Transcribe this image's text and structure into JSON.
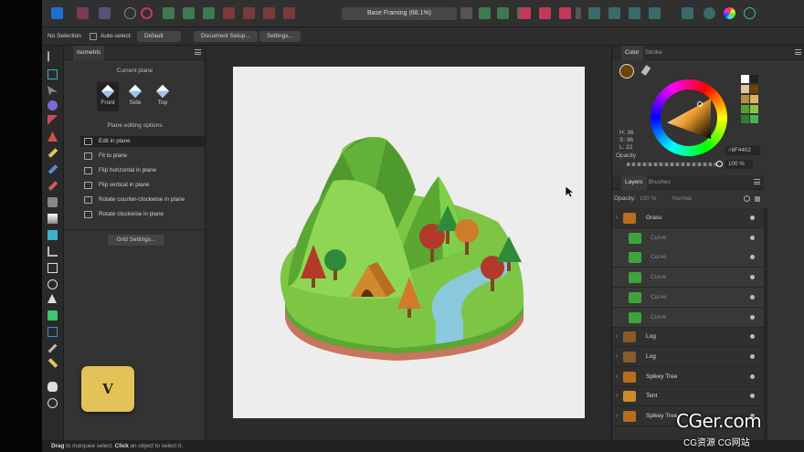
{
  "toolbar": {
    "document_title": "Base Framing (68.1%)"
  },
  "context": {
    "selection": "No Selection",
    "auto_select_label": "Auto-select:",
    "auto_select_value": "Default",
    "doc_setup": "Document Setup...",
    "settings": "Settings..."
  },
  "isometric_panel": {
    "tab": "Isometric",
    "current_plane_label": "Current plane",
    "planes": [
      {
        "label": "Front"
      },
      {
        "label": "Side"
      },
      {
        "label": "Top"
      }
    ],
    "editing_label": "Plane editing options",
    "options": [
      {
        "label": "Edit in plane"
      },
      {
        "label": "Fit to plane"
      },
      {
        "label": "Flip horizontal in plane"
      },
      {
        "label": "Flip vertical in plane"
      },
      {
        "label": "Rotate counter-clockwise in plane"
      },
      {
        "label": "Rotate clockwise in plane"
      }
    ],
    "grid_settings": "Grid Settings..."
  },
  "color_panel": {
    "tabs": [
      "Color",
      "Stroke"
    ],
    "h": "H: 36",
    "s": "S: 96",
    "l": "L: 22",
    "hex": "6F4402",
    "opacity_label": "Opacity",
    "opacity_value": "100 %",
    "swatches": [
      "#ffffff",
      "#222222",
      "#e0c79a",
      "#6f4402",
      "#b78a4a",
      "#d9b26a",
      "#5a9e2f",
      "#8bc34a",
      "#2e7d32",
      "#4caf50"
    ]
  },
  "layers_panel": {
    "tabs": [
      "Layers",
      "Brushes"
    ],
    "opacity_label": "Opacity:",
    "opacity_value": "100 %",
    "blend": "Normal",
    "items": [
      {
        "name": "Grass",
        "indent": false
      },
      {
        "name": "Curve",
        "indent": true
      },
      {
        "name": "Curve",
        "indent": true
      },
      {
        "name": "Curve",
        "indent": true
      },
      {
        "name": "Curve",
        "indent": true
      },
      {
        "name": "Curve",
        "indent": true
      },
      {
        "name": "Log",
        "indent": false
      },
      {
        "name": "Log",
        "indent": false
      },
      {
        "name": "Spikey Tree",
        "indent": false
      },
      {
        "name": "Tent",
        "indent": false
      },
      {
        "name": "Spikey Tree",
        "indent": false
      }
    ]
  },
  "status": {
    "drag": "Drag",
    "mid": " to marquee select. ",
    "click": "Click",
    "end": " an object to select it."
  },
  "key_overlay": "V",
  "watermark": {
    "line1": "CGer.com",
    "line2": "CG资源 CG网站"
  },
  "colors": {
    "accent": "#3d8fd6",
    "key": "#e3c257"
  }
}
